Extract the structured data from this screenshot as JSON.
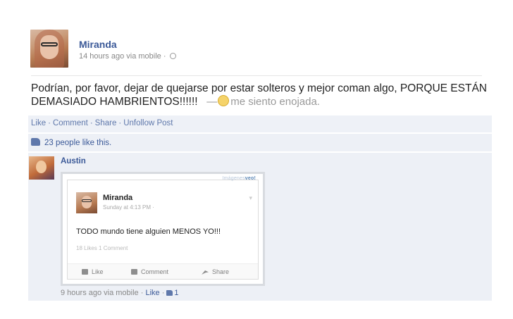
{
  "post": {
    "author": "Miranda",
    "meta": "14 hours ago via mobile ·",
    "text": "Podrían, por favor, dejar de quejarse por estar solteros y mejor coman algo, PORQUE ESTÁN DEMASIADO HAMBRIENTOS!!!!!!",
    "feeling_dash": "—",
    "feeling": "me siento enojada."
  },
  "actions": {
    "like": "Like",
    "comment": "Comment",
    "share": "Share",
    "unfollow": "Unfollow Post",
    "sep": "·"
  },
  "likes": {
    "text": "23 people like this."
  },
  "comment": {
    "author": "Austin",
    "embed": {
      "brand_faint": "Imágenes",
      "brand": "veo!",
      "author": "Miranda",
      "meta": "Sunday at 4:13 PM ·",
      "text": "TODO mundo tiene alguien MENOS YO!!!",
      "counts": "18 Likes   1 Comment",
      "like": "Like",
      "comment": "Comment",
      "share": "Share"
    },
    "meta": "9 hours ago via mobile ·",
    "like": "Like",
    "dot": "·",
    "like_count": "1"
  },
  "icons": {
    "privacy": "globe-icon",
    "feeling": "smiley-icon",
    "likes": "thumbs-up-icon"
  },
  "colors": {
    "link": "#3b5998",
    "action_bar": "#eef1f7"
  }
}
